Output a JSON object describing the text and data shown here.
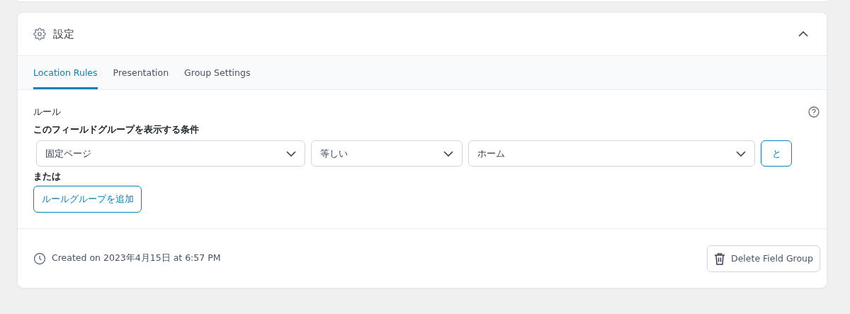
{
  "panel": {
    "title": "設定",
    "expanded": true
  },
  "tabs": [
    {
      "label": "Location Rules",
      "selected": true
    },
    {
      "label": "Presentation",
      "selected": false
    },
    {
      "label": "Group Settings",
      "selected": false
    }
  ],
  "rules": {
    "heading": "ルール",
    "condition_label": "このフィールドグループを表示する条件",
    "row": [
      {
        "value": "固定ページ"
      },
      {
        "value": "等しい"
      },
      {
        "value": "ホーム"
      }
    ],
    "and_button": "と",
    "or_label": "または",
    "add_group_button": "ルールグループを追加"
  },
  "footer": {
    "created": "Created on 2023年4月15日 at 6:57 PM",
    "delete_button": "Delete Field Group"
  }
}
